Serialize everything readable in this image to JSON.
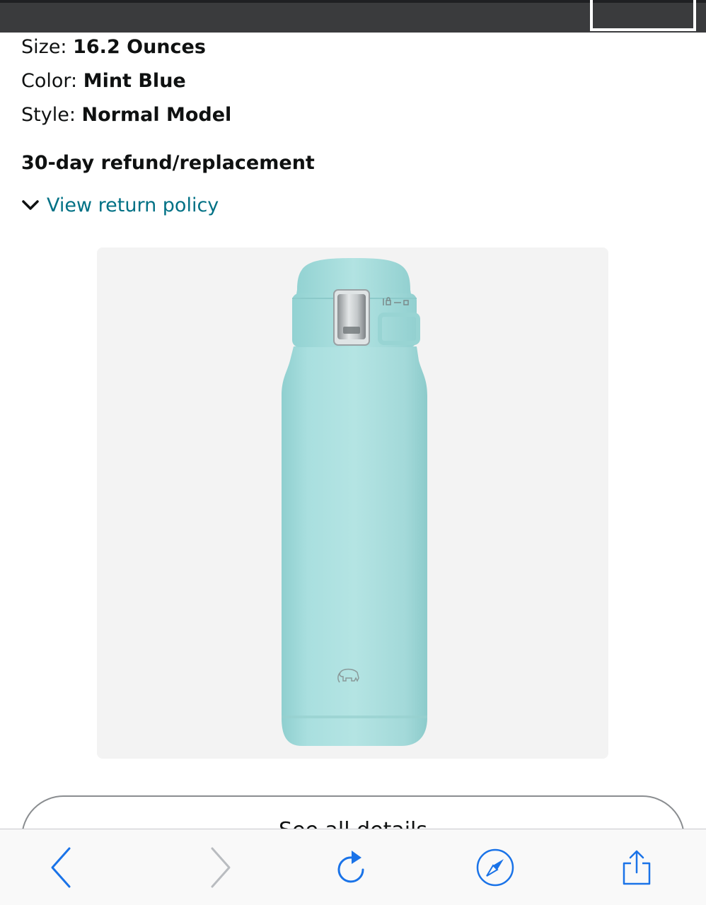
{
  "product": {
    "size_label": "Size: ",
    "size_value": "16.2 Ounces",
    "color_label": "Color: ",
    "color_value": "Mint Blue",
    "style_label": "Style: ",
    "style_value": "Normal Model",
    "refund_text": "30-day refund/replacement",
    "return_link": "View return policy",
    "details_button": "See all details"
  },
  "toolbar": {
    "back_icon": "chevron-left-icon",
    "forward_icon": "chevron-right-icon",
    "reload_icon": "reload-icon",
    "compass_icon": "compass-icon",
    "share_icon": "share-icon"
  },
  "colors": {
    "link": "#007185",
    "ios_blue": "#1a73e8",
    "bottle_mint": "#a6dcdc"
  }
}
